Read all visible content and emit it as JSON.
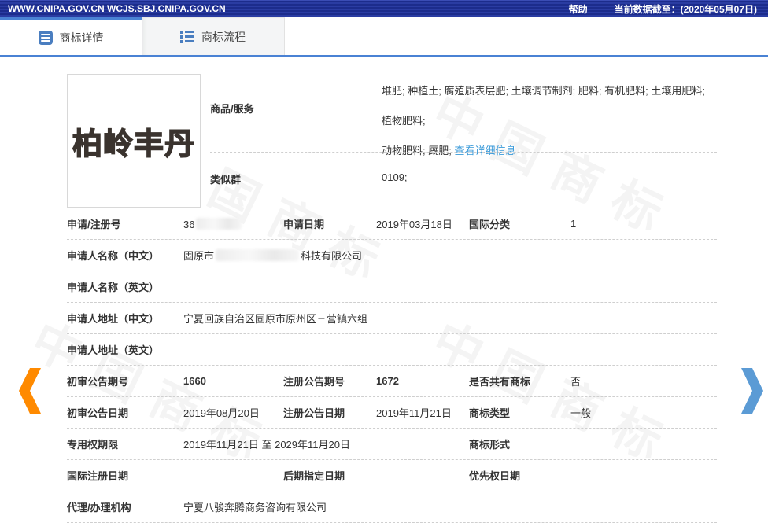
{
  "topbar": {
    "site": "WWW.CNIPA.GOV.CN WCJS.SBJ.CNIPA.GOV.CN",
    "help": "帮助",
    "data_cutoff": "当前数据截至：(2020年05月07日)"
  },
  "tabs": [
    {
      "label": "商标详情",
      "active": true
    },
    {
      "label": "商标流程",
      "active": false
    }
  ],
  "trademark": {
    "name": "柏岭丰丹"
  },
  "goods": {
    "label": "商品/服务",
    "line1": "堆肥; 种植土; 腐殖质表层肥; 土壤调节制剂; 肥料; 有机肥料; 土壤用肥料; 植物肥料;",
    "line2": "动物肥料; 厩肥;",
    "detail_link": "查看详细信息"
  },
  "similar_group": {
    "label": "类似群",
    "value": "0109;"
  },
  "fields": {
    "reg_no": {
      "label": "申请/注册号",
      "value": "36",
      "redacted": true
    },
    "app_date": {
      "label": "申请日期",
      "value": "2019年03月18日"
    },
    "intl_class": {
      "label": "国际分类",
      "value": "1"
    },
    "applicant_cn": {
      "label": "申请人名称（中文）",
      "prefix": "固原市",
      "suffix": "科技有限公司"
    },
    "applicant_en": {
      "label": "申请人名称（英文）",
      "value": ""
    },
    "addr_cn": {
      "label": "申请人地址（中文）",
      "value": "宁夏回族自治区固原市原州区三营镇六组"
    },
    "addr_en": {
      "label": "申请人地址（英文）",
      "value": ""
    },
    "init_gazette_no": {
      "label": "初审公告期号",
      "value": "1660"
    },
    "reg_gazette_no": {
      "label": "注册公告期号",
      "value": "1672"
    },
    "shared_mark": {
      "label": "是否共有商标",
      "value": "否"
    },
    "init_gazette_date": {
      "label": "初审公告日期",
      "value": "2019年08月20日"
    },
    "reg_gazette_date": {
      "label": "注册公告日期",
      "value": "2019年11月21日"
    },
    "mark_type": {
      "label": "商标类型",
      "value": "一般"
    },
    "exclusive_period": {
      "label": "专用权期限",
      "value": "2019年11月21日 至 2029年11月20日"
    },
    "mark_form": {
      "label": "商标形式",
      "value": ""
    },
    "intl_reg_date": {
      "label": "国际注册日期",
      "value": ""
    },
    "late_designation_date": {
      "label": "后期指定日期",
      "value": ""
    },
    "priority_date": {
      "label": "优先权日期",
      "value": ""
    },
    "agent": {
      "label": "代理/办理机构",
      "value": "宁夏八骏奔腾商务咨询有限公司"
    }
  },
  "watermark": {
    "chars": "中国商标"
  },
  "colors": {
    "navy": "#1c2c8c",
    "accent_blue": "#4a82d4",
    "link_blue": "#3a9ad9",
    "arrow_orange": "#ff8a00",
    "arrow_blue": "#5b9bd5"
  }
}
